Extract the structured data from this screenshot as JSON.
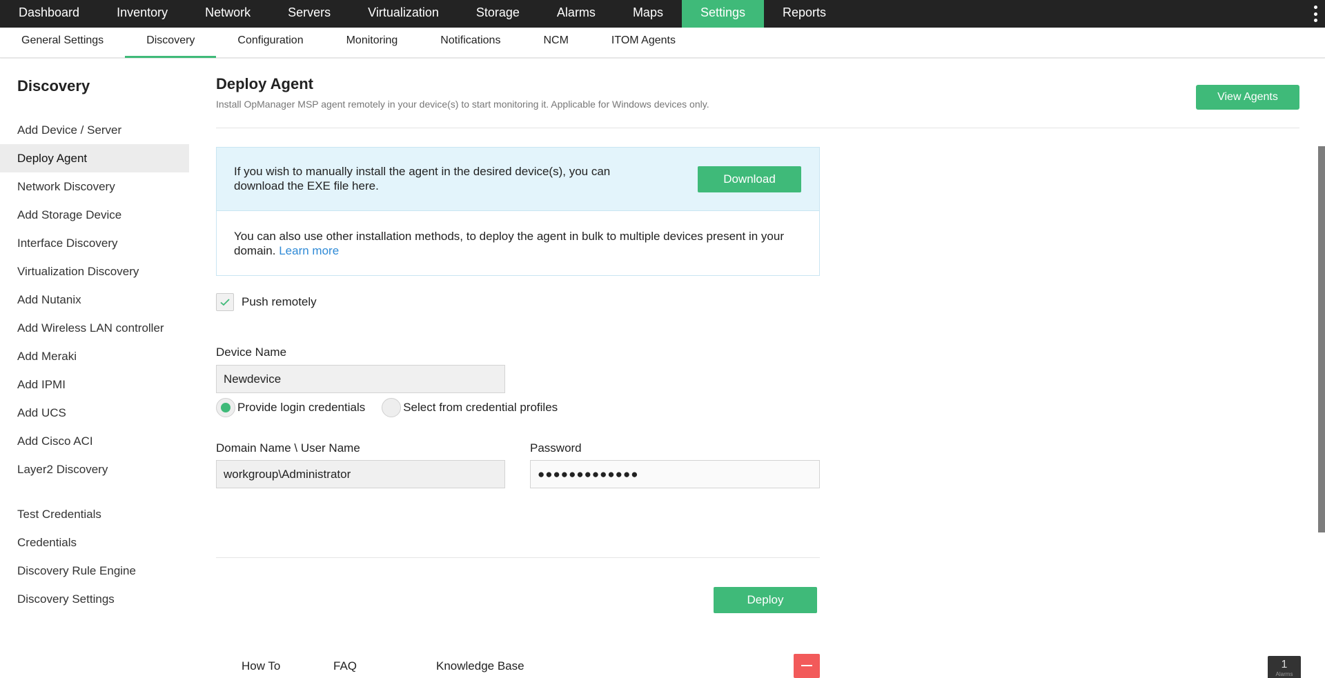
{
  "topnav": {
    "items": [
      "Dashboard",
      "Inventory",
      "Network",
      "Servers",
      "Virtualization",
      "Storage",
      "Alarms",
      "Maps",
      "Settings",
      "Reports"
    ],
    "active": "Settings",
    "menu_icon": "kebab-menu-icon"
  },
  "subnav": {
    "items": [
      "General Settings",
      "Discovery",
      "Configuration",
      "Monitoring",
      "Notifications",
      "NCM",
      "ITOM Agents"
    ],
    "active": "Discovery"
  },
  "sidebar": {
    "title": "Discovery",
    "items": [
      "Add Device / Server",
      "Deploy Agent",
      "Network Discovery",
      "Add Storage Device",
      "Interface Discovery",
      "Virtualization Discovery",
      "Add Nutanix",
      "Add Wireless LAN controller",
      "Add Meraki",
      "Add IPMI",
      "Add UCS",
      "Add Cisco ACI",
      "Layer2 Discovery"
    ],
    "active": "Deploy Agent",
    "items2": [
      "Test Credentials",
      "Credentials",
      "Discovery Rule Engine",
      "Discovery Settings"
    ]
  },
  "main": {
    "title": "Deploy Agent",
    "description": "Install OpManager MSP agent remotely in your device(s) to start monitoring it. Applicable for Windows devices only.",
    "view_agents_label": "View Agents",
    "info": {
      "manual_text": "If you wish to manually install the agent in the desired device(s), you can download the EXE file here.",
      "download_label": "Download",
      "bulk_text": "You can also use other installation methods, to deploy the agent in bulk to multiple devices present in your domain.",
      "learn_more_label": "Learn more"
    },
    "push_remotely": {
      "label": "Push remotely",
      "checked": true
    },
    "device_name": {
      "label": "Device Name",
      "value": "Newdevice"
    },
    "credential_options": [
      {
        "label": "Provide login credentials",
        "selected": true
      },
      {
        "label": "Select from credential profiles",
        "selected": false
      }
    ],
    "username": {
      "label": "Domain Name \\ User Name",
      "value": "workgroup\\Administrator"
    },
    "password": {
      "label": "Password",
      "value": "●●●●●●●●●●●●●"
    },
    "deploy_label": "Deploy",
    "footer_links": [
      "How To",
      "FAQ",
      "Knowledge Base"
    ],
    "alarm_badge": {
      "count": "1",
      "label": "Alarms"
    }
  },
  "colors": {
    "accent": "#3fba79",
    "topbar": "#232323",
    "link": "#2f8ad6",
    "danger": "#f25a5a"
  }
}
